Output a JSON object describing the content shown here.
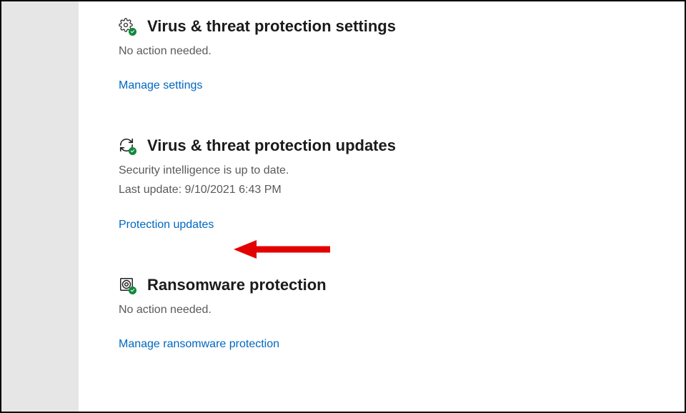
{
  "sections": {
    "settings": {
      "title": "Virus & threat protection settings",
      "status": "No action needed.",
      "link": "Manage settings"
    },
    "updates": {
      "title": "Virus & threat protection updates",
      "status": "Security intelligence is up to date.",
      "last_update": "Last update: 9/10/2021 6:43 PM",
      "link": "Protection updates"
    },
    "ransomware": {
      "title": "Ransomware protection",
      "status": "No action needed.",
      "link": "Manage ransomware protection"
    }
  },
  "colors": {
    "link": "#0067c0",
    "check": "#10893e",
    "arrow": "#e30000"
  }
}
